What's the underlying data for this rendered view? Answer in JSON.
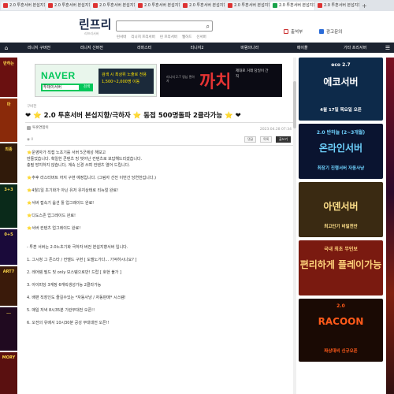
{
  "browser": {
    "tabs": [
      {
        "label": "2.0 투혼서버 본섭지향/극...",
        "color": "#d33",
        "active": false
      },
      {
        "label": "2.0 투혼서버 본섭지향/극...",
        "color": "#d33",
        "active": false
      },
      {
        "label": "2.0 투혼서버 본섭지향/극...",
        "color": "#d33",
        "active": false
      },
      {
        "label": "2.0 투혼서버 본섭지향/극...",
        "color": "#d33",
        "active": false
      },
      {
        "label": "2.0 투혼서버 본섭지향/극...",
        "color": "#d33",
        "active": false
      },
      {
        "label": "2.0 투혼서버 본섭지향/극...",
        "color": "#d33",
        "active": false
      },
      {
        "label": "2.0 투혼서버 본섭지향/극...",
        "color": "#1aa34a",
        "active": true
      },
      {
        "label": "2.0 투혼서버 본섭지향/극...",
        "color": "#d33",
        "active": false
      }
    ],
    "new_tab": "+"
  },
  "header": {
    "logo": "린프리",
    "logo_sub": "리프리서버",
    "quick_links": [
      "린서버",
      "리니지 프리서버",
      "린 프리서버",
      "웹하드",
      "신서버"
    ],
    "login": "출석부",
    "ad": "광고문의"
  },
  "nav": {
    "home_icon": "⌂",
    "items": [
      "리니지 구버전",
      "리니지 신버전",
      "리마스터",
      "리니지2",
      "바람의나라",
      "메이플",
      "기타 프리서버"
    ],
    "menu_icon": "☰"
  },
  "banners": {
    "naver": {
      "logo": "NAVER",
      "query": "투데이서버",
      "button": "검색",
      "promo": "검색 시 최상위 노출로 전용 1,500~2,000명 이동"
    },
    "kkachi": {
      "sub": "리니지 2.7 앵님 랜하자",
      "title": "까치",
      "tag": "제대로 거래 당일이 간직"
    }
  },
  "post": {
    "category": "구비전",
    "title": "❤ ⭐ 2.0 투혼서버 본섭지향/극하자 ⭐ 동접 500명돌파 2클라가능 ⭐ ❤",
    "author": "투혼연합이",
    "date": "2023.04.28 07:34",
    "views": "0",
    "btn_reply": "댓글",
    "btn_list": "목록",
    "btn_write": "글쓰기",
    "lines": [
      "⭐운영자가 직접 노초기를 서버 5군에성 해보고",
      "만들었습니다. 획일한 콘텐츠 밍 벗어난 컨텐츠로 보답해드리겠습니다.",
      "충필 방지하지 않습니다, 계속 신경 쓰며 컨텐츠 열어 드립니다.",
      "",
      "⭐추후 라스터버트 까지 구현 예정입니다. (그림자 선전 이번건 당연한겁니다.)",
      "",
      "⭐4월1일 초기화가 아닌 유저 유지상태로 리뉴얼 완료!",
      "",
      "⭐서버 접속기 옵션 툴 업그레이드 완료!",
      "",
      "⭐디도스존 업그레이드 완료!",
      "",
      "⭐서버 컨텐츠 업그레이드 완료!",
      "",
      "",
      "- 투혼 서버는 2.0노초기화 극하자 버전 본섭지향서버 입니다.",
      "",
      "1. 그시청 그 존스타 / 컨텔드 구현 [ 도텔노가다... 기억하시나요? ]",
      "",
      "2. 레어템 필드 및 only 보스템으로만! 드랍 [ 호현 불가 ]",
      "",
      "3. 아이피당 3계정 6캐릭생성가능 2클라가능",
      "",
      "4. 배편 직장인도 즐길수있는 *자동사냥 / 자동판매* 시스템!",
      "",
      "5. 매일 저녁 8시35분 기란무대전 오픈!!",
      "",
      "6. 오전의 유배서 10시30분 공성 무대대전 오픈!!"
    ]
  },
  "right_ads": [
    {
      "line1": "eco 2.7",
      "line2": "에코서버",
      "line3": "4월 17일 목요일 오픈",
      "bg": "#0d2a4a",
      "fg": "#ffffff"
    },
    {
      "line1": "2.0 반하늘 (2~3개월)",
      "line2": "온라인서버",
      "line3": "최장기 진행서버 자동사냥",
      "bg": "#0a1430",
      "fg": "#6fd3ff"
    },
    {
      "line1": "",
      "line2": "아덴서버",
      "line3": "최고인기 비밀천안",
      "bg": "#3a2a12",
      "fg": "#ffe08a"
    },
    {
      "line1": "국내 최초 무인보",
      "line2": "편리하게 플레이가능",
      "line3": "",
      "bg": "#7a1a10",
      "fg": "#ffd27a"
    },
    {
      "line1": "2.0",
      "line2": "RACOON",
      "line3": "짜상대비 신규오픈",
      "bg": "#1a0a04",
      "fg": "#ff5a1a"
    }
  ],
  "left_ads": [
    "반하는",
    "마",
    "최종",
    "3+3",
    "0+5",
    "ART7",
    "...",
    "MORY"
  ]
}
